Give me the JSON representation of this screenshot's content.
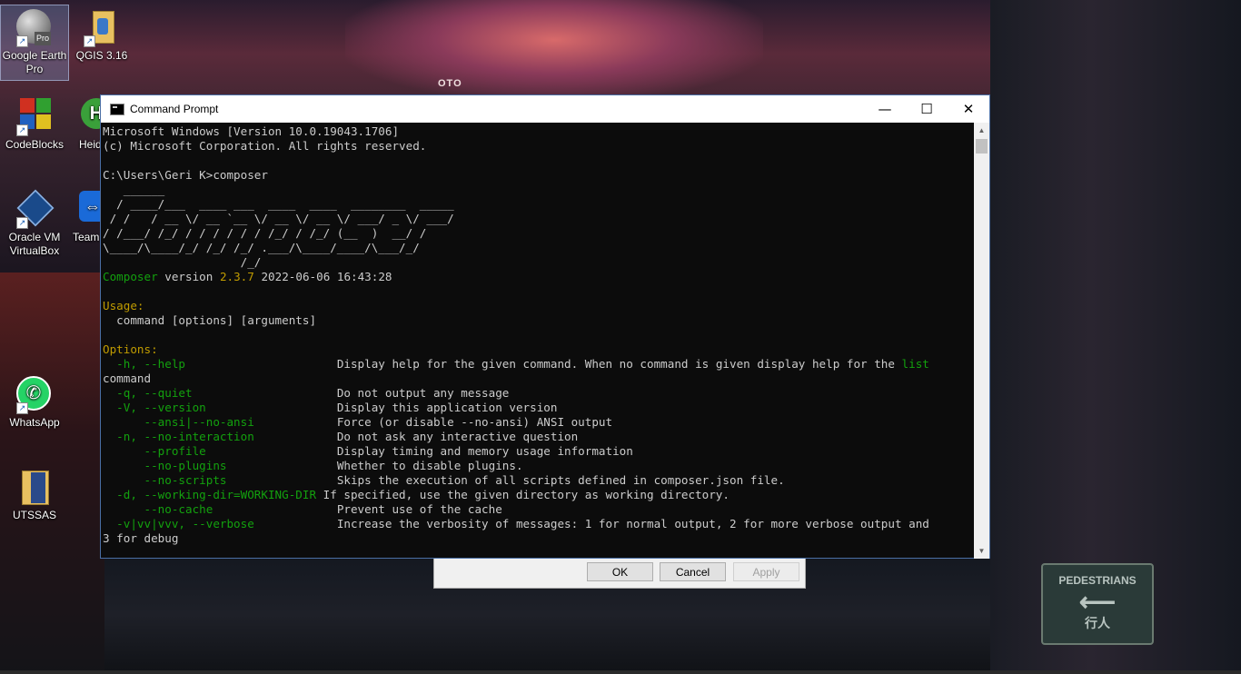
{
  "desktop": {
    "icons": [
      {
        "label": "Google Earth Pro",
        "badge": "Pro"
      },
      {
        "label": "QGIS 3.16"
      },
      {
        "label": "CodeBlocks"
      },
      {
        "label": "Heid"
      },
      {
        "label": "Oracle VM VirtualBox"
      },
      {
        "label": "Team"
      },
      {
        "label": "WhatsApp"
      },
      {
        "label": "UTSSAS"
      }
    ],
    "street_sign": {
      "text": "PEDESTRIANS",
      "hanzi": "行人"
    },
    "billboard_text": "OTO"
  },
  "window": {
    "title": "Command Prompt",
    "minimize": "—",
    "maximize": "☐",
    "close": "✕"
  },
  "terminal": {
    "header_line1": "Microsoft Windows [Version 10.0.19043.1706]",
    "header_line2": "(c) Microsoft Corporation. All rights reserved.",
    "prompt": "C:\\Users\\Geri K>composer",
    "logo": [
      "   ______",
      "  / ____/___  ____ ___  ____  ____  ________  _____",
      " / /   / __ \\/ __ `__ \\/ __ \\/ __ \\/ ___/ _ \\/ ___/",
      "/ /___/ /_/ / / / / / / /_/ / /_/ (__  )  __/ /",
      "\\____/\\____/_/ /_/ /_/ .___/\\____/____/\\___/_/",
      "                    /_/"
    ],
    "version_label": "Composer",
    "version_word": "version",
    "version_number": "2.3.7",
    "version_date": "2022-06-06 16:43:28",
    "usage_heading": "Usage:",
    "usage_line": "  command [options] [arguments]",
    "options_heading": "Options:",
    "options": [
      {
        "flag": "  -h, --help                  ",
        "desc": "Display help for the given command. When no command is given display help for the ",
        "link": "list",
        "wrap": "command"
      },
      {
        "flag": "  -q, --quiet                 ",
        "desc": "Do not output any message"
      },
      {
        "flag": "  -V, --version               ",
        "desc": "Display this application version"
      },
      {
        "flag": "      --ansi|--no-ansi        ",
        "desc": "Force (or disable --no-ansi) ANSI output"
      },
      {
        "flag": "  -n, --no-interaction        ",
        "desc": "Do not ask any interactive question"
      },
      {
        "flag": "      --profile               ",
        "desc": "Display timing and memory usage information"
      },
      {
        "flag": "      --no-plugins            ",
        "desc": "Whether to disable plugins."
      },
      {
        "flag": "      --no-scripts            ",
        "desc": "Skips the execution of all scripts defined in composer.json file."
      },
      {
        "flag": "  -d, --working-dir=WORKING-DIR",
        "desc": " If specified, use the given directory as working directory."
      },
      {
        "flag": "      --no-cache              ",
        "desc": "Prevent use of the cache"
      },
      {
        "flag": "  -v|vv|vvv, --verbose        ",
        "desc": "Increase the verbosity of messages: 1 for normal output, 2 for more verbose output and",
        "wrap": "3 for debug"
      }
    ]
  },
  "dialog": {
    "ok": "OK",
    "cancel": "Cancel",
    "apply": "Apply"
  },
  "colors": {
    "terminal_bg": "#0c0c0c",
    "terminal_fg": "#cccccc",
    "green": "#13a10e",
    "yellow": "#c19c00",
    "window_border": "#4a6fa5"
  }
}
